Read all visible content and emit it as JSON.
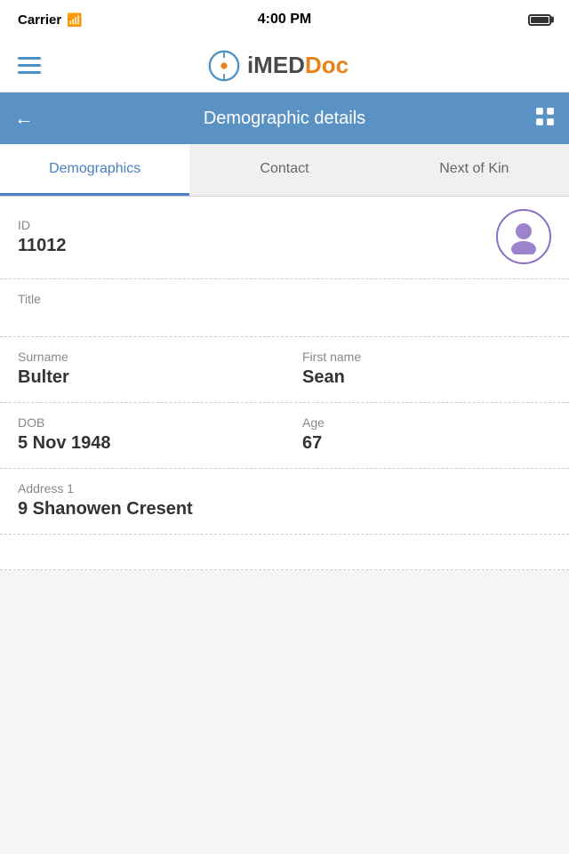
{
  "status_bar": {
    "carrier": "Carrier",
    "time": "4:00 PM"
  },
  "nav_header": {
    "logo_imed": "iMED",
    "logo_doc": "Doc"
  },
  "page_header": {
    "title": "Demographic details",
    "back_label": "←",
    "grid_label": "⊞"
  },
  "tabs": [
    {
      "label": "Demographics",
      "active": true
    },
    {
      "label": "Contact",
      "active": false
    },
    {
      "label": "Next of Kin",
      "active": false
    }
  ],
  "fields": {
    "id_label": "ID",
    "id_value": "11012",
    "title_label": "Title",
    "title_value": "",
    "surname_label": "Surname",
    "surname_value": "Bulter",
    "firstname_label": "First name",
    "firstname_value": "Sean",
    "dob_label": "DOB",
    "dob_value": "5 Nov 1948",
    "age_label": "Age",
    "age_value": "67",
    "address1_label": "Address 1",
    "address1_value": "9 Shanowen Cresent"
  }
}
